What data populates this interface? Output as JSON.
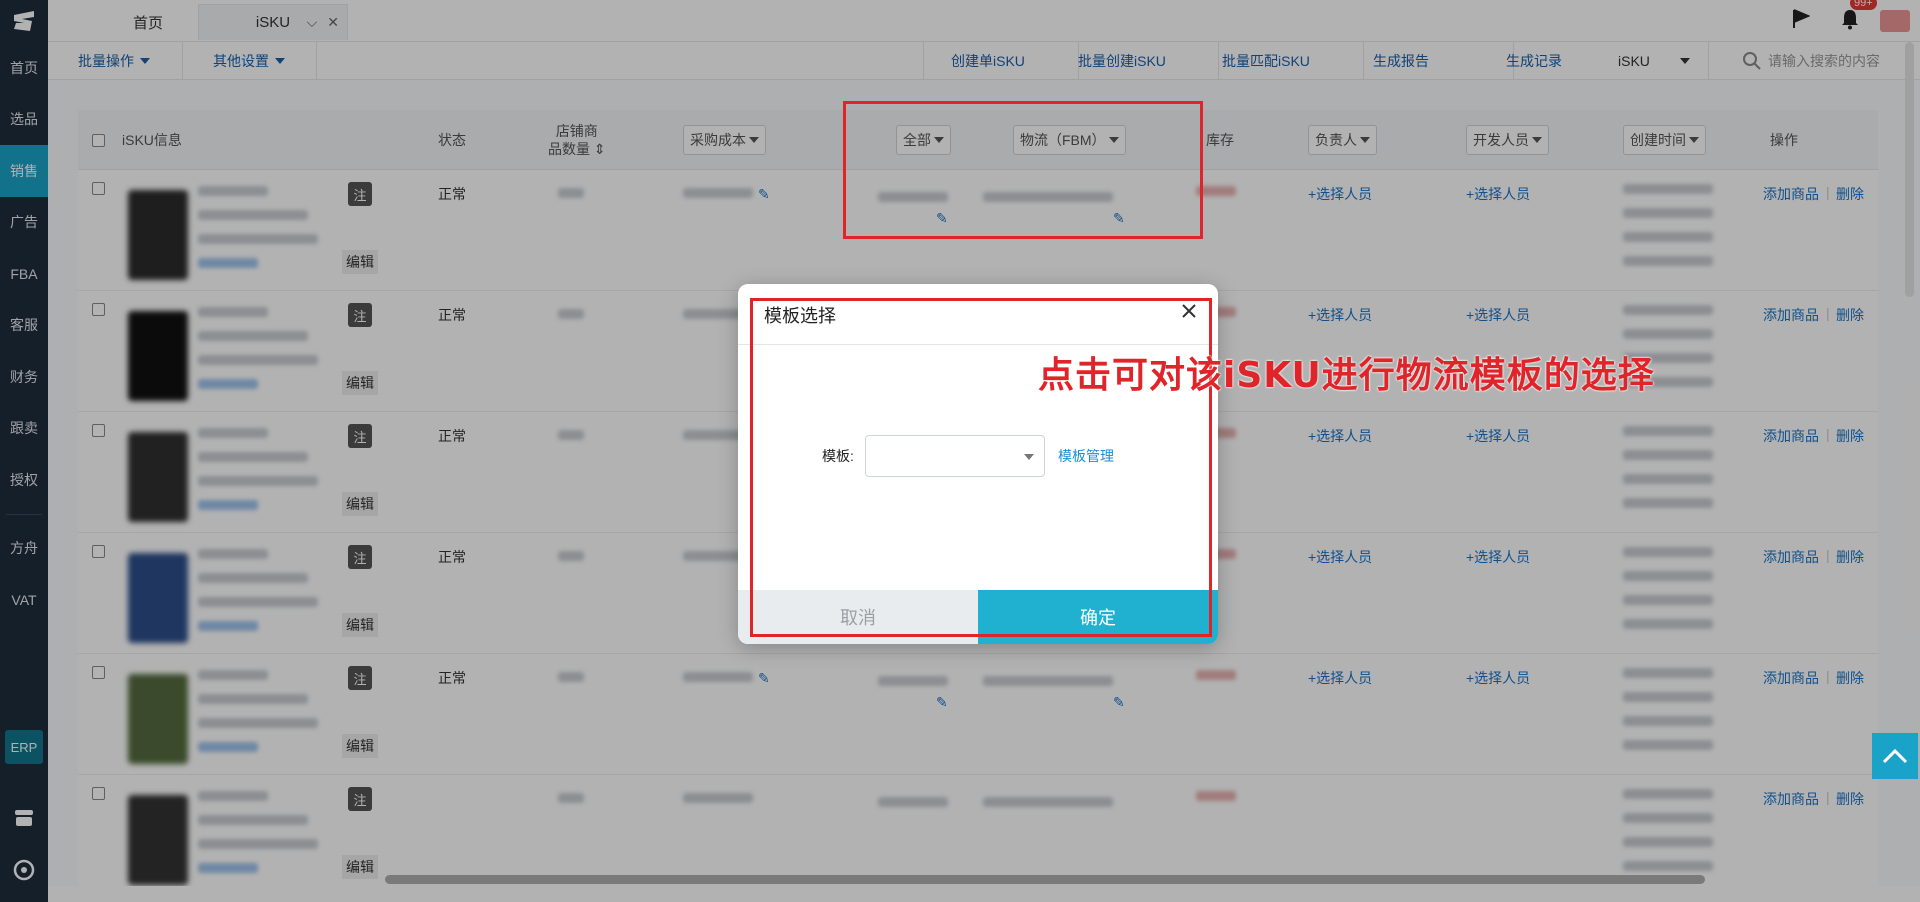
{
  "sidebar": {
    "items": [
      {
        "label": "首页"
      },
      {
        "label": "选品"
      },
      {
        "label": "销售"
      },
      {
        "label": "广告"
      },
      {
        "label": "FBA"
      },
      {
        "label": "客服"
      },
      {
        "label": "财务"
      },
      {
        "label": "跟卖"
      },
      {
        "label": "授权"
      },
      {
        "label": "方舟"
      },
      {
        "label": "VAT"
      }
    ],
    "active": "销售",
    "erp_label": "ERP"
  },
  "tabs": {
    "home": "首页",
    "isku": "iSKU"
  },
  "notifications": {
    "badge": "99+"
  },
  "toolbar": {
    "bulk_ops": "批量操作",
    "other_settings": "其他设置",
    "create_single": "创建单iSKU",
    "bulk_create": "批量创建iSKU",
    "bulk_match": "批量匹配iSKU",
    "gen_report": "生成报告",
    "gen_record": "生成记录",
    "scope_select": "iSKU",
    "search_placeholder": "请输入搜索的内容"
  },
  "table": {
    "headers": {
      "info": "iSKU信息",
      "status": "状态",
      "shop_count_line1": "店铺商",
      "shop_count_line2": "品数量",
      "purchase_cost": "采购成本",
      "all": "全部",
      "logistics": "物流（FBM）",
      "stock": "库存",
      "owner": "负责人",
      "developer": "开发人员",
      "created_time": "创建时间",
      "actions": "操作"
    },
    "rows": [
      {
        "tag": "注",
        "edit": "编辑",
        "status": "正常",
        "owner": "+选择人员",
        "developer": "+选择人员",
        "add": "添加商品",
        "delete": "删除"
      },
      {
        "tag": "注",
        "edit": "编辑",
        "status": "正常",
        "owner": "+选择人员",
        "developer": "+选择人员",
        "add": "添加商品",
        "delete": "删除"
      },
      {
        "tag": "注",
        "edit": "编辑",
        "status": "正常",
        "owner": "+选择人员",
        "developer": "+选择人员",
        "add": "添加商品",
        "delete": "删除"
      },
      {
        "tag": "注",
        "edit": "编辑",
        "status": "正常",
        "owner": "+选择人员",
        "developer": "+选择人员",
        "add": "添加商品",
        "delete": "删除"
      },
      {
        "tag": "注",
        "edit": "编辑",
        "status": "正常",
        "owner": "+选择人员",
        "developer": "+选择人员",
        "add": "添加商品",
        "delete": "删除"
      },
      {
        "tag": "注",
        "edit": "编辑",
        "status": "",
        "owner": "",
        "developer": "",
        "add": "添加商品",
        "delete": "删除"
      }
    ]
  },
  "modal": {
    "title": "模板选择",
    "field_label": "模板:",
    "select_value": "",
    "manage_link": "模板管理",
    "cancel": "取消",
    "confirm": "确定"
  },
  "annotation": {
    "text": "点击可对该iSKU进行物流模板的选择",
    "color": "#e0252a"
  },
  "colors": {
    "sidebar_bg": "#1f2d3d",
    "accent": "#1fb1cf",
    "link": "#1a73c8"
  }
}
